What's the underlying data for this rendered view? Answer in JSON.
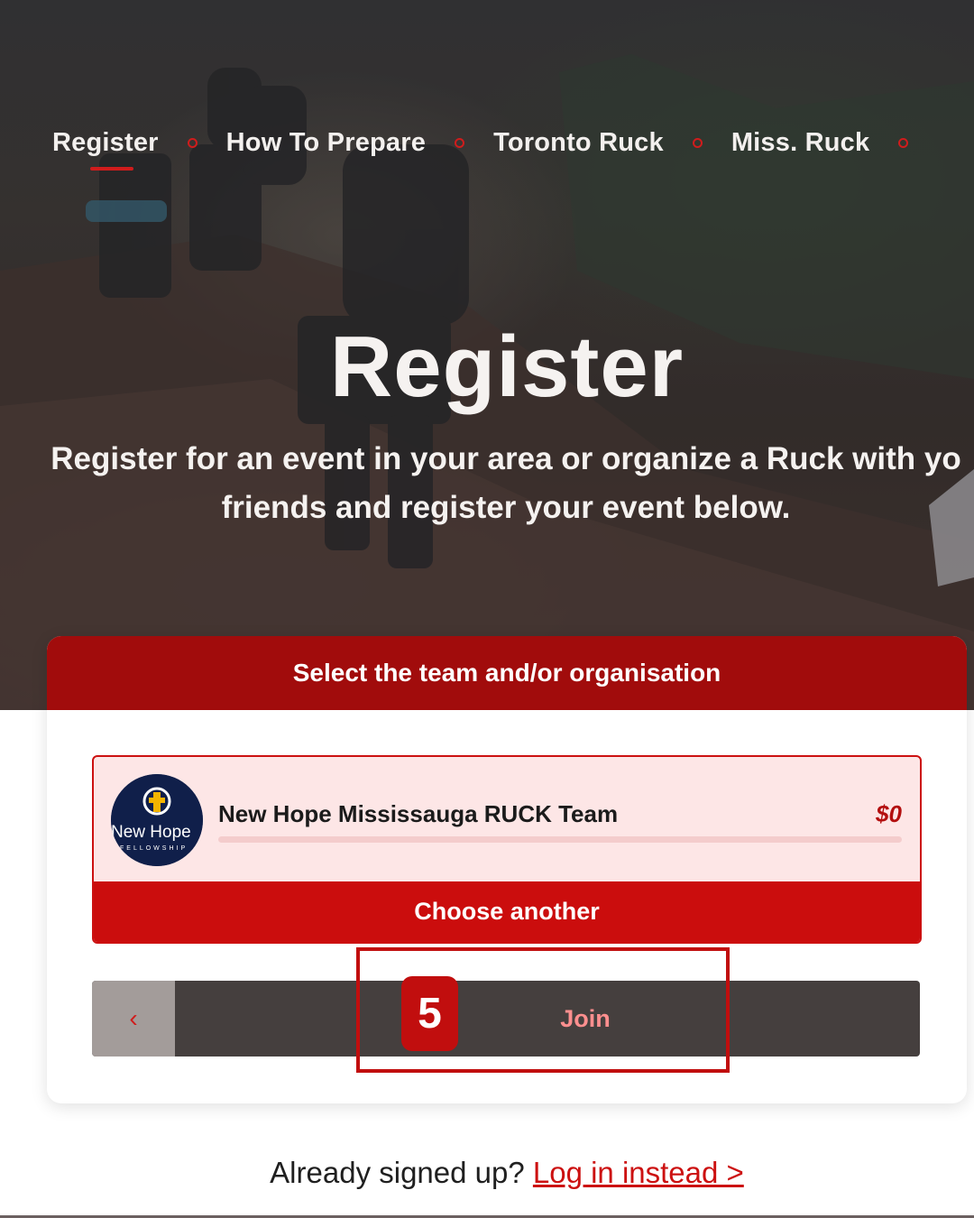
{
  "nav": {
    "items": [
      {
        "label": "Register",
        "active": true
      },
      {
        "label": "How To Prepare",
        "active": false
      },
      {
        "label": "Toronto Ruck",
        "active": false
      },
      {
        "label": "Miss. Ruck",
        "active": false
      }
    ]
  },
  "hero": {
    "title": "Register",
    "subtitle": "Register for an event in your area or organize a Ruck with yo\nfriends and register your event below."
  },
  "card": {
    "header": "Select the team and/or organisation",
    "team": {
      "name": "New Hope Mississauga RUCK Team",
      "price": "$0",
      "logo_text": "New Hope",
      "logo_subtext": "FELLOWSHIP"
    },
    "choose_another_label": "Choose another",
    "back_icon": "‹",
    "join_label": "Join"
  },
  "annotation": {
    "step": "5"
  },
  "footer": {
    "prompt": "Already signed up?",
    "login_link": "Log in instead >"
  },
  "colors": {
    "brand_red": "#cb0d0d",
    "header_red": "#a10c0c",
    "dark_button": "#453f3e"
  }
}
